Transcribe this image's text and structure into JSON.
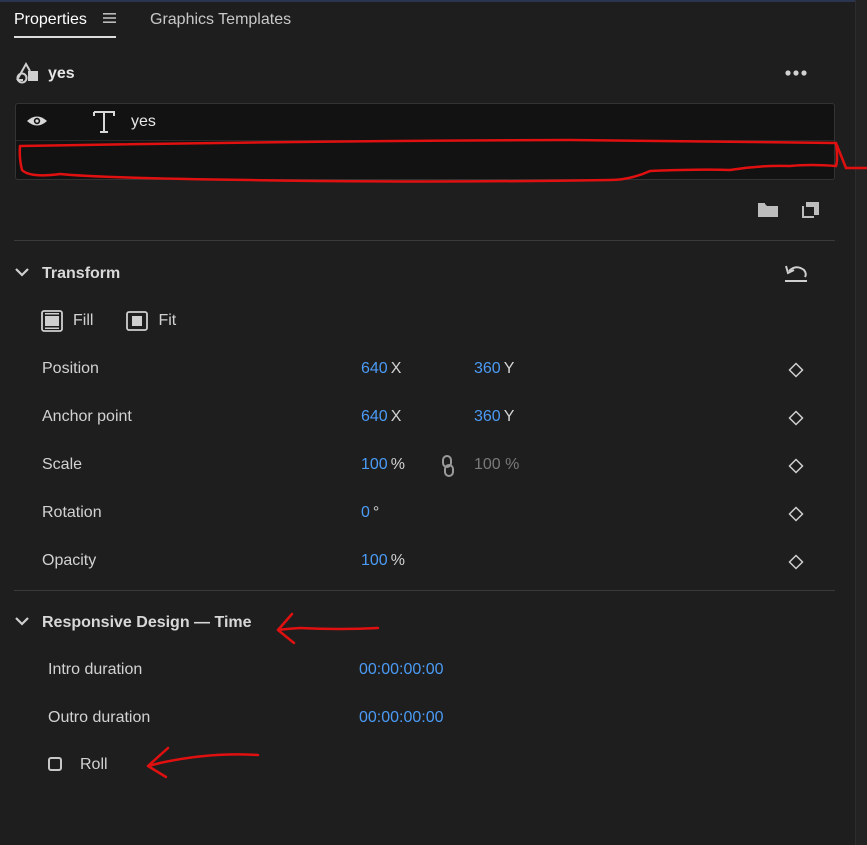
{
  "tabs": [
    {
      "label": "Properties",
      "active": true
    },
    {
      "label": "Graphics Templates",
      "active": false
    }
  ],
  "layer": {
    "name": "yes",
    "rows": [
      {
        "icon": "text-icon",
        "label": "yes"
      }
    ]
  },
  "transform": {
    "title": "Transform",
    "fill_label": "Fill",
    "fit_label": "Fit",
    "properties": [
      {
        "label": "Position",
        "x": "640",
        "x_unit": "X",
        "y": "360",
        "y_unit": "Y"
      },
      {
        "label": "Anchor point",
        "x": "640",
        "x_unit": "X",
        "y": "360",
        "y_unit": "Y"
      },
      {
        "label": "Scale",
        "value": "100",
        "unit": "%",
        "linked_value": "100 %"
      },
      {
        "label": "Rotation",
        "value": "0",
        "unit": "°"
      },
      {
        "label": "Opacity",
        "value": "100",
        "unit": "%"
      }
    ]
  },
  "responsive": {
    "title": "Responsive Design — Time",
    "intro_label": "Intro duration",
    "intro_value": "00:00:00:00",
    "outro_label": "Outro duration",
    "outro_value": "00:00:00:00",
    "roll_label": "Roll",
    "roll_checked": false
  },
  "colors": {
    "accent": "#4b9bf5",
    "annotation": "#e01010",
    "background": "#1e1e1e"
  }
}
